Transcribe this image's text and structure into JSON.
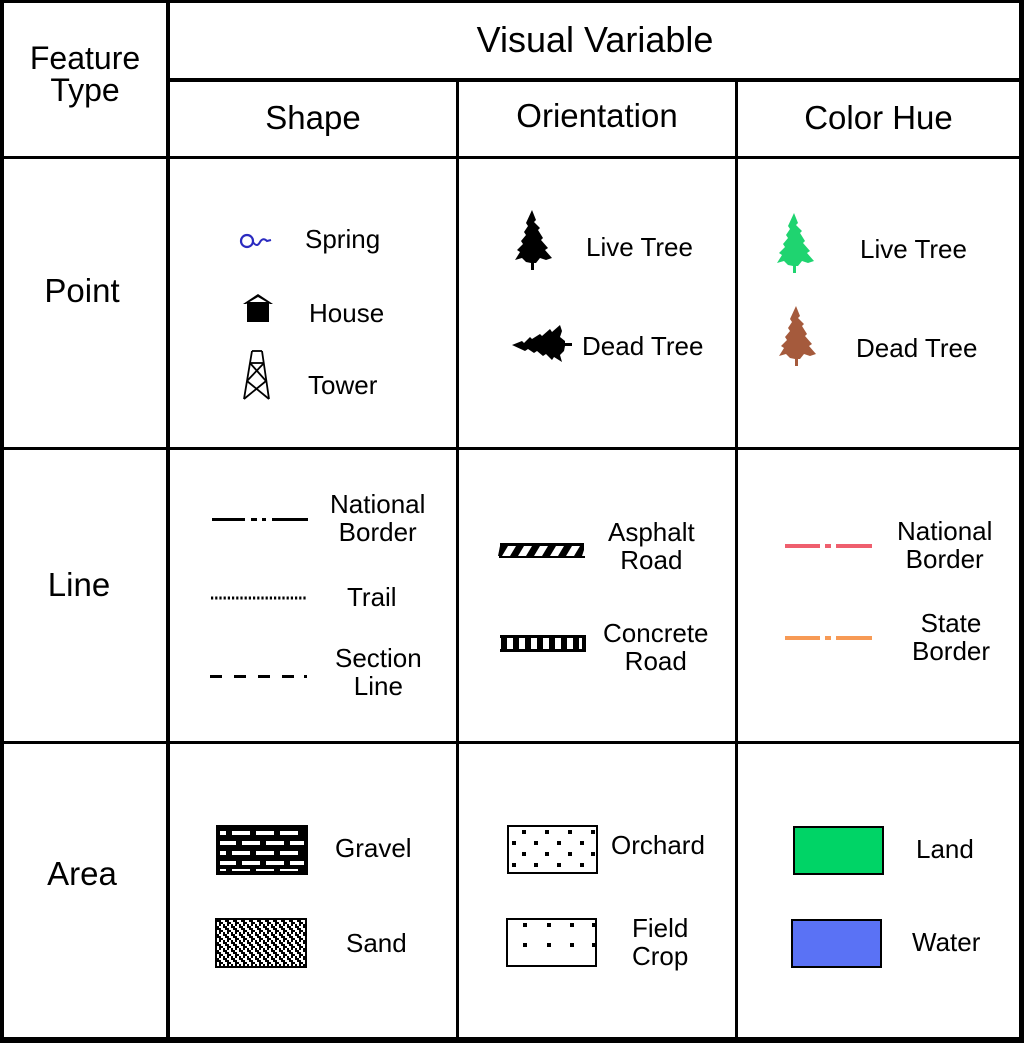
{
  "header": {
    "feature_type": [
      "Feature",
      "Type"
    ],
    "visual_variable": "Visual Variable",
    "columns": [
      "Shape",
      "Orientation",
      "Color Hue"
    ]
  },
  "rows": {
    "point": {
      "label": "Point",
      "shape": [
        "Spring",
        "House",
        "Tower"
      ],
      "orientation": [
        "Live Tree",
        "Dead Tree"
      ],
      "color_hue": [
        "Live Tree",
        "Dead Tree"
      ]
    },
    "line": {
      "label": "Line",
      "shape": [
        [
          "National",
          "Border"
        ],
        [
          "Trail"
        ],
        [
          "Section",
          "Line"
        ]
      ],
      "orientation": [
        [
          "Asphalt",
          "Road"
        ],
        [
          "Concrete",
          "Road"
        ]
      ],
      "color_hue": [
        [
          "National",
          "Border"
        ],
        [
          "State",
          "Border"
        ]
      ]
    },
    "area": {
      "label": "Area",
      "shape": [
        "Gravel",
        "Sand"
      ],
      "orientation": [
        "Orchard",
        [
          "Field",
          "Crop"
        ]
      ],
      "color_hue": [
        "Land",
        "Water"
      ]
    }
  },
  "colors": {
    "spring": "#2b2bc0",
    "live_tree": "#1fd470",
    "dead_tree": "#a55a3c",
    "national_border": "#ef5f6e",
    "state_border": "#f79a55",
    "land": "#00d466",
    "water": "#5a72f5"
  }
}
